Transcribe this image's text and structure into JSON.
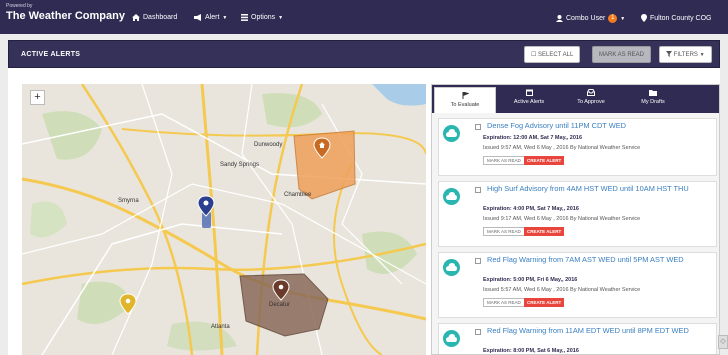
{
  "header": {
    "powered_by": "Powered by",
    "brand": "The Weather Company",
    "nav": {
      "dashboard": "Dashboard",
      "alert": "Alert",
      "options": "Options"
    },
    "user": "Combo User",
    "user_badge": "1",
    "county": "Fulton County COG"
  },
  "panel": {
    "title": "ACTIVE ALERTS",
    "select_all": "SELECT ALL",
    "mark_as_read": "MARK AS READ",
    "filters": "FILTERS"
  },
  "map": {
    "zoom_in": "+",
    "labels": {
      "dunwoody": "Dunwoody",
      "sandy_springs": "Sandy Springs",
      "chamblee": "Chamblee",
      "smyrna": "Smyrna",
      "decatur": "Decatur",
      "atlanta": "Atlanta"
    },
    "colors": {
      "orange_polygon": "#f0a05a",
      "brown_polygon": "#8a6a5a",
      "blue_marker": "#2a3f8f"
    }
  },
  "tabs": [
    {
      "label": "To Evaluate",
      "icon": "flag-icon"
    },
    {
      "label": "Active Alerts",
      "icon": "calendar-icon"
    },
    {
      "label": "To Approve",
      "icon": "inbox-icon"
    },
    {
      "label": "My Drafts",
      "icon": "folder-icon"
    }
  ],
  "alerts": [
    {
      "title": "Dense Fog Advisory until 11PM CDT WED",
      "expiration": "Expiration: 12:00 AM, Sat 7 May,, 2016",
      "issued": "Issued 9:57 AM, Wed 6 May , 2016 By National Weather Service",
      "mark_read": "MARK AS READ",
      "create_alert": "CREATE ALERT"
    },
    {
      "title": "High Surf Advisory from 4AM HST WED until 10AM HST THU",
      "expiration": "Expiration: 4:00 PM, Sat 7 May,, 2016",
      "issued": "Issued 9:17 AM, Wed 6 May , 2016 By National Weather Service",
      "mark_read": "MARK AS READ",
      "create_alert": "CREATE ALERT"
    },
    {
      "title": "Red Flag Warning from 7AM AST WED until 5PM AST WED",
      "expiration": "Expiration: 5:00 PM, Fri 6 May,, 2016",
      "issued": "Issued 5:57 AM, Wed 6 May , 2016 By National Weather Service",
      "mark_read": "MARK AS READ",
      "create_alert": "CREATE ALERT"
    },
    {
      "title": "Red Flag Warning from 11AM EDT WED until 8PM EDT WED",
      "expiration": "Expiration: 8:00 PM, Sat 6 May,, 2016"
    }
  ],
  "accent": {
    "header_bg": "#2f2b52",
    "alert_icon": "#2ab6b0",
    "create_button": "#e8453c",
    "title_link": "#3a7fc0"
  }
}
